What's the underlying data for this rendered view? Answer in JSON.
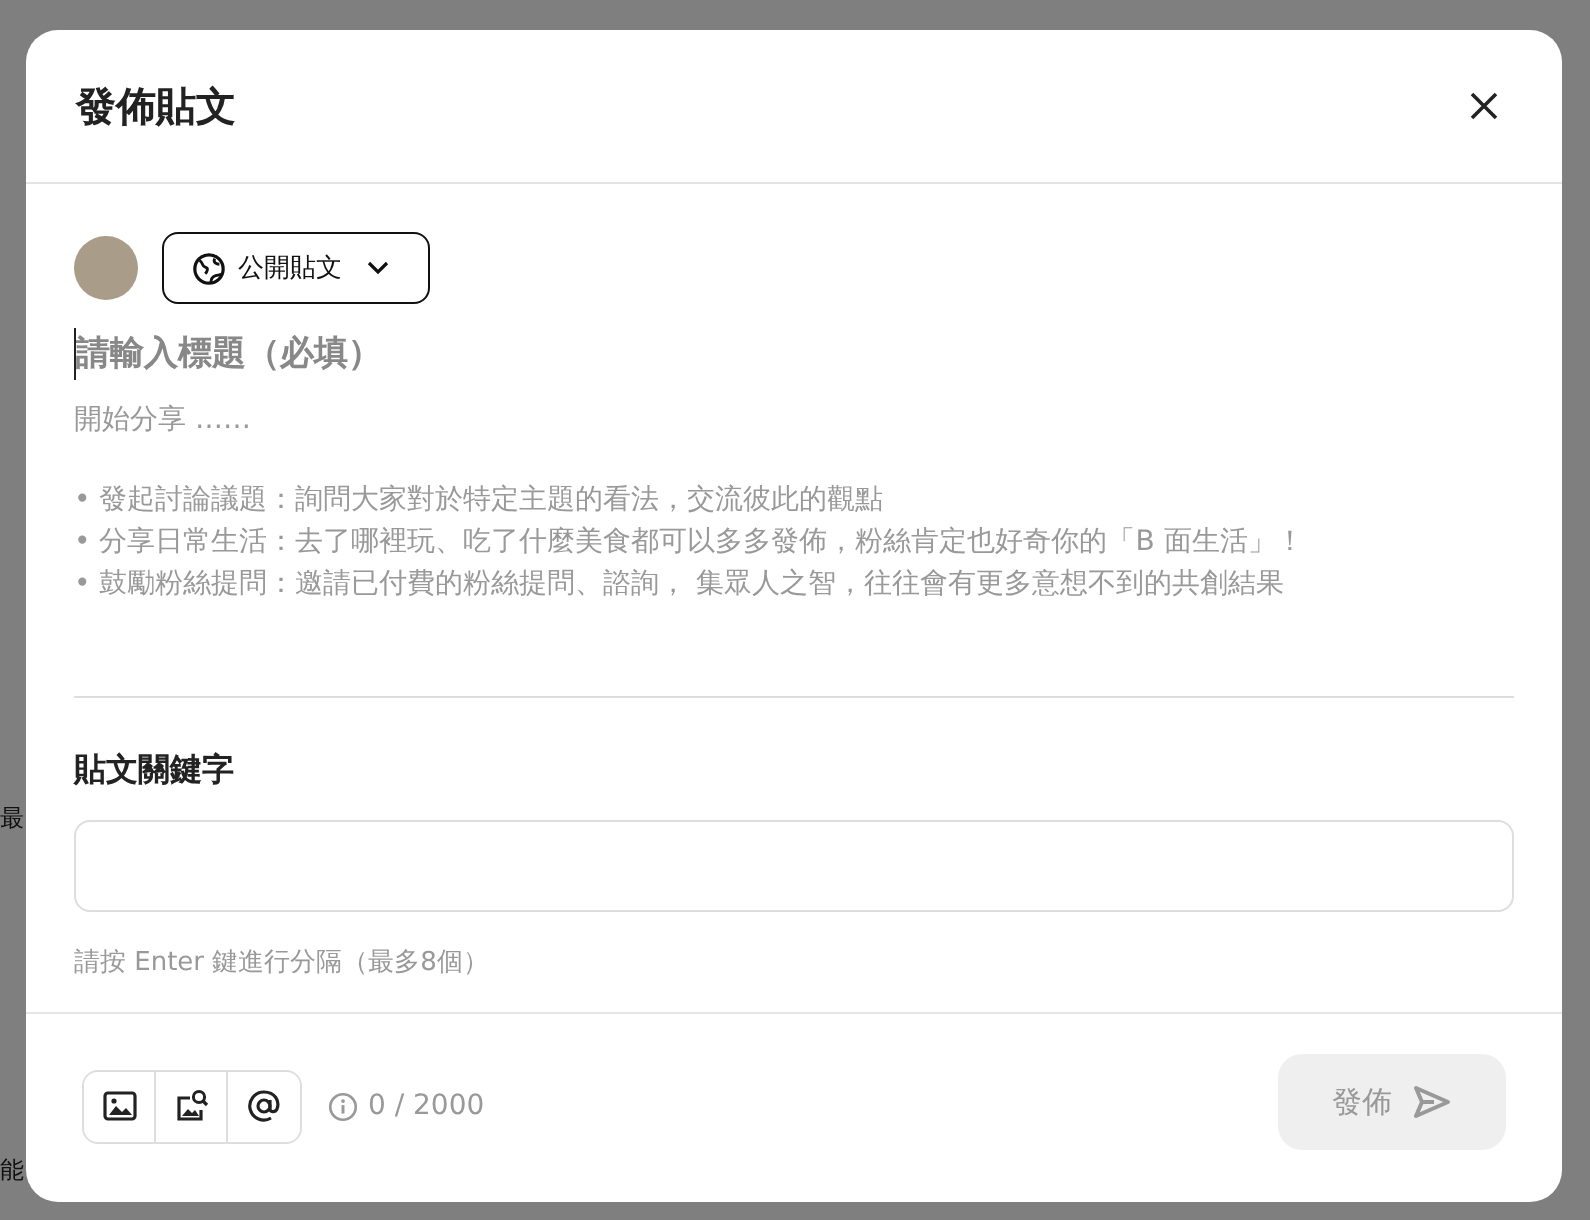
{
  "background": {
    "fragments": [
      "最",
      "能"
    ]
  },
  "dialog": {
    "title": "發佈貼文",
    "audience": {
      "label": "公開貼文"
    },
    "post_title": {
      "placeholder": "請輸入標題（必填）"
    },
    "content": {
      "placeholder": "開始分享 ……",
      "tips": [
        "• 發起討論議題：詢問大家對於特定主題的看法，交流彼此的觀點",
        "• 分享日常生活：去了哪裡玩、吃了什麼美食都可以多多發佈，粉絲肯定也好奇你的「B 面生活」！",
        "• 鼓勵粉絲提問：邀請已付費的粉絲提問、諮詢， 集眾人之智，往往會有更多意想不到的共創結果"
      ]
    },
    "keywords": {
      "label": "貼文關鍵字",
      "hint": "請按 Enter 鍵進行分隔（最多8個）"
    },
    "counter": "0 / 2000",
    "publish": {
      "label": "發佈",
      "disabled": true
    }
  }
}
